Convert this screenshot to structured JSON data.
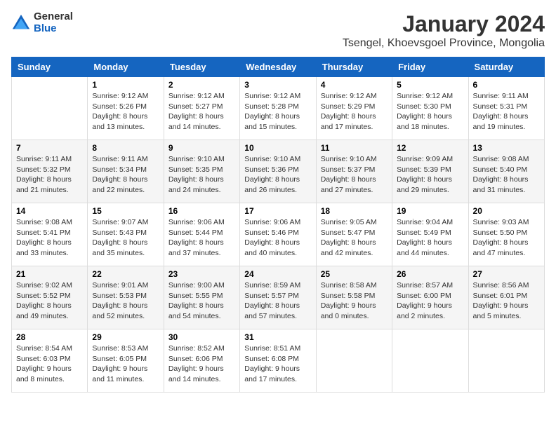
{
  "logo": {
    "general": "General",
    "blue": "Blue"
  },
  "title": "January 2024",
  "subtitle": "Tsengel, Khoevsgoel Province, Mongolia",
  "days_of_week": [
    "Sunday",
    "Monday",
    "Tuesday",
    "Wednesday",
    "Thursday",
    "Friday",
    "Saturday"
  ],
  "weeks": [
    [
      {
        "day": "",
        "sunrise": "",
        "sunset": "",
        "daylight": ""
      },
      {
        "day": "1",
        "sunrise": "Sunrise: 9:12 AM",
        "sunset": "Sunset: 5:26 PM",
        "daylight": "Daylight: 8 hours and 13 minutes."
      },
      {
        "day": "2",
        "sunrise": "Sunrise: 9:12 AM",
        "sunset": "Sunset: 5:27 PM",
        "daylight": "Daylight: 8 hours and 14 minutes."
      },
      {
        "day": "3",
        "sunrise": "Sunrise: 9:12 AM",
        "sunset": "Sunset: 5:28 PM",
        "daylight": "Daylight: 8 hours and 15 minutes."
      },
      {
        "day": "4",
        "sunrise": "Sunrise: 9:12 AM",
        "sunset": "Sunset: 5:29 PM",
        "daylight": "Daylight: 8 hours and 17 minutes."
      },
      {
        "day": "5",
        "sunrise": "Sunrise: 9:12 AM",
        "sunset": "Sunset: 5:30 PM",
        "daylight": "Daylight: 8 hours and 18 minutes."
      },
      {
        "day": "6",
        "sunrise": "Sunrise: 9:11 AM",
        "sunset": "Sunset: 5:31 PM",
        "daylight": "Daylight: 8 hours and 19 minutes."
      }
    ],
    [
      {
        "day": "7",
        "sunrise": "Sunrise: 9:11 AM",
        "sunset": "Sunset: 5:32 PM",
        "daylight": "Daylight: 8 hours and 21 minutes."
      },
      {
        "day": "8",
        "sunrise": "Sunrise: 9:11 AM",
        "sunset": "Sunset: 5:34 PM",
        "daylight": "Daylight: 8 hours and 22 minutes."
      },
      {
        "day": "9",
        "sunrise": "Sunrise: 9:10 AM",
        "sunset": "Sunset: 5:35 PM",
        "daylight": "Daylight: 8 hours and 24 minutes."
      },
      {
        "day": "10",
        "sunrise": "Sunrise: 9:10 AM",
        "sunset": "Sunset: 5:36 PM",
        "daylight": "Daylight: 8 hours and 26 minutes."
      },
      {
        "day": "11",
        "sunrise": "Sunrise: 9:10 AM",
        "sunset": "Sunset: 5:37 PM",
        "daylight": "Daylight: 8 hours and 27 minutes."
      },
      {
        "day": "12",
        "sunrise": "Sunrise: 9:09 AM",
        "sunset": "Sunset: 5:39 PM",
        "daylight": "Daylight: 8 hours and 29 minutes."
      },
      {
        "day": "13",
        "sunrise": "Sunrise: 9:08 AM",
        "sunset": "Sunset: 5:40 PM",
        "daylight": "Daylight: 8 hours and 31 minutes."
      }
    ],
    [
      {
        "day": "14",
        "sunrise": "Sunrise: 9:08 AM",
        "sunset": "Sunset: 5:41 PM",
        "daylight": "Daylight: 8 hours and 33 minutes."
      },
      {
        "day": "15",
        "sunrise": "Sunrise: 9:07 AM",
        "sunset": "Sunset: 5:43 PM",
        "daylight": "Daylight: 8 hours and 35 minutes."
      },
      {
        "day": "16",
        "sunrise": "Sunrise: 9:06 AM",
        "sunset": "Sunset: 5:44 PM",
        "daylight": "Daylight: 8 hours and 37 minutes."
      },
      {
        "day": "17",
        "sunrise": "Sunrise: 9:06 AM",
        "sunset": "Sunset: 5:46 PM",
        "daylight": "Daylight: 8 hours and 40 minutes."
      },
      {
        "day": "18",
        "sunrise": "Sunrise: 9:05 AM",
        "sunset": "Sunset: 5:47 PM",
        "daylight": "Daylight: 8 hours and 42 minutes."
      },
      {
        "day": "19",
        "sunrise": "Sunrise: 9:04 AM",
        "sunset": "Sunset: 5:49 PM",
        "daylight": "Daylight: 8 hours and 44 minutes."
      },
      {
        "day": "20",
        "sunrise": "Sunrise: 9:03 AM",
        "sunset": "Sunset: 5:50 PM",
        "daylight": "Daylight: 8 hours and 47 minutes."
      }
    ],
    [
      {
        "day": "21",
        "sunrise": "Sunrise: 9:02 AM",
        "sunset": "Sunset: 5:52 PM",
        "daylight": "Daylight: 8 hours and 49 minutes."
      },
      {
        "day": "22",
        "sunrise": "Sunrise: 9:01 AM",
        "sunset": "Sunset: 5:53 PM",
        "daylight": "Daylight: 8 hours and 52 minutes."
      },
      {
        "day": "23",
        "sunrise": "Sunrise: 9:00 AM",
        "sunset": "Sunset: 5:55 PM",
        "daylight": "Daylight: 8 hours and 54 minutes."
      },
      {
        "day": "24",
        "sunrise": "Sunrise: 8:59 AM",
        "sunset": "Sunset: 5:57 PM",
        "daylight": "Daylight: 8 hours and 57 minutes."
      },
      {
        "day": "25",
        "sunrise": "Sunrise: 8:58 AM",
        "sunset": "Sunset: 5:58 PM",
        "daylight": "Daylight: 9 hours and 0 minutes."
      },
      {
        "day": "26",
        "sunrise": "Sunrise: 8:57 AM",
        "sunset": "Sunset: 6:00 PM",
        "daylight": "Daylight: 9 hours and 2 minutes."
      },
      {
        "day": "27",
        "sunrise": "Sunrise: 8:56 AM",
        "sunset": "Sunset: 6:01 PM",
        "daylight": "Daylight: 9 hours and 5 minutes."
      }
    ],
    [
      {
        "day": "28",
        "sunrise": "Sunrise: 8:54 AM",
        "sunset": "Sunset: 6:03 PM",
        "daylight": "Daylight: 9 hours and 8 minutes."
      },
      {
        "day": "29",
        "sunrise": "Sunrise: 8:53 AM",
        "sunset": "Sunset: 6:05 PM",
        "daylight": "Daylight: 9 hours and 11 minutes."
      },
      {
        "day": "30",
        "sunrise": "Sunrise: 8:52 AM",
        "sunset": "Sunset: 6:06 PM",
        "daylight": "Daylight: 9 hours and 14 minutes."
      },
      {
        "day": "31",
        "sunrise": "Sunrise: 8:51 AM",
        "sunset": "Sunset: 6:08 PM",
        "daylight": "Daylight: 9 hours and 17 minutes."
      },
      {
        "day": "",
        "sunrise": "",
        "sunset": "",
        "daylight": ""
      },
      {
        "day": "",
        "sunrise": "",
        "sunset": "",
        "daylight": ""
      },
      {
        "day": "",
        "sunrise": "",
        "sunset": "",
        "daylight": ""
      }
    ]
  ]
}
